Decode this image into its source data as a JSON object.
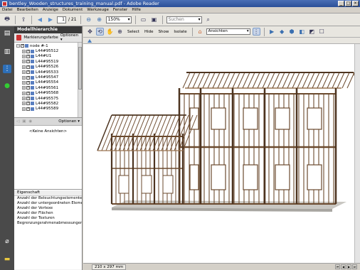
{
  "window": {
    "title": "bentley_Wooden_structures_training_manual.pdf - Adobe Reader",
    "controls": [
      "_",
      "□",
      "×"
    ]
  },
  "menu": [
    "Datei",
    "Bearbeiten",
    "Anzeige",
    "Dokument",
    "Werkzeuge",
    "Fenster",
    "Hilfe"
  ],
  "toolbar": {
    "page_current": "1",
    "page_total": "/ 21",
    "zoom": "150%",
    "search_placeholder": "Suchen"
  },
  "sidebar_tabs": [
    "pages-icon",
    "attachments-icon",
    "model-tree-icon",
    "layers-icon",
    "paperclip-icon",
    "comments-icon"
  ],
  "panel": {
    "title": "Modellhierarchie",
    "marking_color": "Markierungsfarbe",
    "options": "Optionen",
    "tree": [
      {
        "label": "node #-1",
        "level": 0,
        "expand": "−"
      },
      {
        "label": "L44#95512",
        "level": 1,
        "expand": "+"
      },
      {
        "label": "L44#U1",
        "level": 1,
        "expand": "+"
      },
      {
        "label": "L44#95519",
        "level": 1,
        "expand": "+"
      },
      {
        "label": "L44#95526",
        "level": 1,
        "expand": "+"
      },
      {
        "label": "L44#95533",
        "level": 1,
        "expand": "+"
      },
      {
        "label": "L44#95547",
        "level": 1,
        "expand": "+"
      },
      {
        "label": "L44#95554",
        "level": 1,
        "expand": "+"
      },
      {
        "label": "L44#95561",
        "level": 1,
        "expand": "+"
      },
      {
        "label": "L44#95568",
        "level": 1,
        "expand": "+"
      },
      {
        "label": "L44#95575",
        "level": 1,
        "expand": "+"
      },
      {
        "label": "L44#95582",
        "level": 1,
        "expand": "+"
      },
      {
        "label": "L44#95589",
        "level": 1,
        "expand": "+"
      }
    ],
    "views_options": "Optionen",
    "no_views": "<Keine Ansichten>",
    "properties_header": "Eigenschaft",
    "properties": [
      "Anzahl der Beleuchtungselemente",
      "Anzahl der untergeordneten Elemente",
      "Anzahl der Vertexe",
      "Anzahl der Flächen",
      "Anzahl der Texturen",
      "Begrenzungsrahmenabmessungen (M"
    ]
  },
  "toolbar3d": {
    "select": "Select",
    "hide": "Hide",
    "show": "Show",
    "isolate": "Isolate",
    "views": "Ansichten"
  },
  "status": {
    "page_size": "210 x 297 mm"
  },
  "colors": {
    "wood": "#6b4a2e",
    "wood_light": "#9a7552",
    "floor": "#c9c7c2",
    "accent": "#4a7fc0"
  }
}
